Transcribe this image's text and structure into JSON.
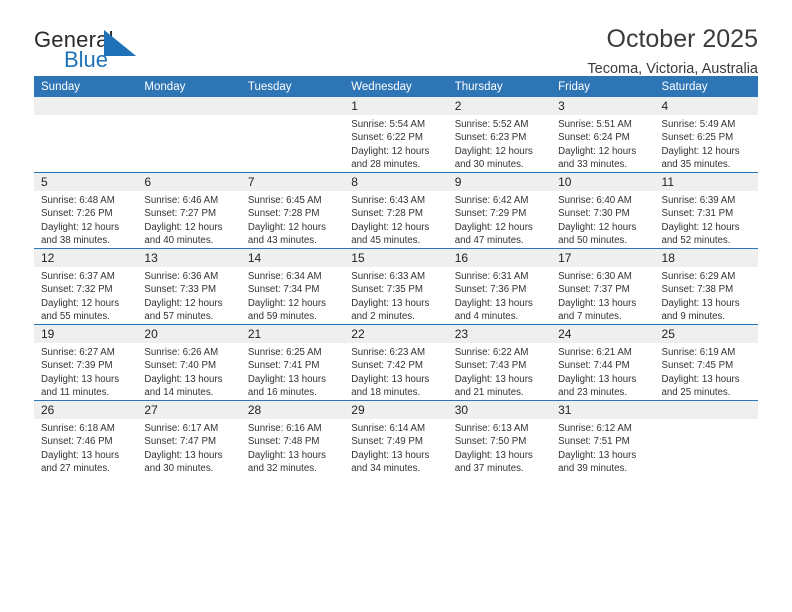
{
  "brand": {
    "name_part1": "General",
    "name_part2": "Blue",
    "triangle_color": "#1f72b8",
    "icon": "triangle-icon"
  },
  "header": {
    "title": "October 2025",
    "location": "Tecoma, Victoria, Australia"
  },
  "colors": {
    "header_blue": "#2e75b6",
    "daynum_band": "#efefef",
    "text": "#333333"
  },
  "weekdays": [
    "Sunday",
    "Monday",
    "Tuesday",
    "Wednesday",
    "Thursday",
    "Friday",
    "Saturday"
  ],
  "labels": {
    "sunrise": "Sunrise:",
    "sunset": "Sunset:",
    "daylight": "Daylight:"
  },
  "weeks": [
    [
      {
        "day": "",
        "empty": true
      },
      {
        "day": "",
        "empty": true
      },
      {
        "day": "",
        "empty": true
      },
      {
        "day": "1",
        "sunrise": "Sunrise: 5:54 AM",
        "sunset": "Sunset: 6:22 PM",
        "daylight_line1": "Daylight: 12 hours",
        "daylight_line2": "and 28 minutes."
      },
      {
        "day": "2",
        "sunrise": "Sunrise: 5:52 AM",
        "sunset": "Sunset: 6:23 PM",
        "daylight_line1": "Daylight: 12 hours",
        "daylight_line2": "and 30 minutes."
      },
      {
        "day": "3",
        "sunrise": "Sunrise: 5:51 AM",
        "sunset": "Sunset: 6:24 PM",
        "daylight_line1": "Daylight: 12 hours",
        "daylight_line2": "and 33 minutes."
      },
      {
        "day": "4",
        "sunrise": "Sunrise: 5:49 AM",
        "sunset": "Sunset: 6:25 PM",
        "daylight_line1": "Daylight: 12 hours",
        "daylight_line2": "and 35 minutes."
      }
    ],
    [
      {
        "day": "5",
        "sunrise": "Sunrise: 6:48 AM",
        "sunset": "Sunset: 7:26 PM",
        "daylight_line1": "Daylight: 12 hours",
        "daylight_line2": "and 38 minutes."
      },
      {
        "day": "6",
        "sunrise": "Sunrise: 6:46 AM",
        "sunset": "Sunset: 7:27 PM",
        "daylight_line1": "Daylight: 12 hours",
        "daylight_line2": "and 40 minutes."
      },
      {
        "day": "7",
        "sunrise": "Sunrise: 6:45 AM",
        "sunset": "Sunset: 7:28 PM",
        "daylight_line1": "Daylight: 12 hours",
        "daylight_line2": "and 43 minutes."
      },
      {
        "day": "8",
        "sunrise": "Sunrise: 6:43 AM",
        "sunset": "Sunset: 7:28 PM",
        "daylight_line1": "Daylight: 12 hours",
        "daylight_line2": "and 45 minutes."
      },
      {
        "day": "9",
        "sunrise": "Sunrise: 6:42 AM",
        "sunset": "Sunset: 7:29 PM",
        "daylight_line1": "Daylight: 12 hours",
        "daylight_line2": "and 47 minutes."
      },
      {
        "day": "10",
        "sunrise": "Sunrise: 6:40 AM",
        "sunset": "Sunset: 7:30 PM",
        "daylight_line1": "Daylight: 12 hours",
        "daylight_line2": "and 50 minutes."
      },
      {
        "day": "11",
        "sunrise": "Sunrise: 6:39 AM",
        "sunset": "Sunset: 7:31 PM",
        "daylight_line1": "Daylight: 12 hours",
        "daylight_line2": "and 52 minutes."
      }
    ],
    [
      {
        "day": "12",
        "sunrise": "Sunrise: 6:37 AM",
        "sunset": "Sunset: 7:32 PM",
        "daylight_line1": "Daylight: 12 hours",
        "daylight_line2": "and 55 minutes."
      },
      {
        "day": "13",
        "sunrise": "Sunrise: 6:36 AM",
        "sunset": "Sunset: 7:33 PM",
        "daylight_line1": "Daylight: 12 hours",
        "daylight_line2": "and 57 minutes."
      },
      {
        "day": "14",
        "sunrise": "Sunrise: 6:34 AM",
        "sunset": "Sunset: 7:34 PM",
        "daylight_line1": "Daylight: 12 hours",
        "daylight_line2": "and 59 minutes."
      },
      {
        "day": "15",
        "sunrise": "Sunrise: 6:33 AM",
        "sunset": "Sunset: 7:35 PM",
        "daylight_line1": "Daylight: 13 hours",
        "daylight_line2": "and 2 minutes."
      },
      {
        "day": "16",
        "sunrise": "Sunrise: 6:31 AM",
        "sunset": "Sunset: 7:36 PM",
        "daylight_line1": "Daylight: 13 hours",
        "daylight_line2": "and 4 minutes."
      },
      {
        "day": "17",
        "sunrise": "Sunrise: 6:30 AM",
        "sunset": "Sunset: 7:37 PM",
        "daylight_line1": "Daylight: 13 hours",
        "daylight_line2": "and 7 minutes."
      },
      {
        "day": "18",
        "sunrise": "Sunrise: 6:29 AM",
        "sunset": "Sunset: 7:38 PM",
        "daylight_line1": "Daylight: 13 hours",
        "daylight_line2": "and 9 minutes."
      }
    ],
    [
      {
        "day": "19",
        "sunrise": "Sunrise: 6:27 AM",
        "sunset": "Sunset: 7:39 PM",
        "daylight_line1": "Daylight: 13 hours",
        "daylight_line2": "and 11 minutes."
      },
      {
        "day": "20",
        "sunrise": "Sunrise: 6:26 AM",
        "sunset": "Sunset: 7:40 PM",
        "daylight_line1": "Daylight: 13 hours",
        "daylight_line2": "and 14 minutes."
      },
      {
        "day": "21",
        "sunrise": "Sunrise: 6:25 AM",
        "sunset": "Sunset: 7:41 PM",
        "daylight_line1": "Daylight: 13 hours",
        "daylight_line2": "and 16 minutes."
      },
      {
        "day": "22",
        "sunrise": "Sunrise: 6:23 AM",
        "sunset": "Sunset: 7:42 PM",
        "daylight_line1": "Daylight: 13 hours",
        "daylight_line2": "and 18 minutes."
      },
      {
        "day": "23",
        "sunrise": "Sunrise: 6:22 AM",
        "sunset": "Sunset: 7:43 PM",
        "daylight_line1": "Daylight: 13 hours",
        "daylight_line2": "and 21 minutes."
      },
      {
        "day": "24",
        "sunrise": "Sunrise: 6:21 AM",
        "sunset": "Sunset: 7:44 PM",
        "daylight_line1": "Daylight: 13 hours",
        "daylight_line2": "and 23 minutes."
      },
      {
        "day": "25",
        "sunrise": "Sunrise: 6:19 AM",
        "sunset": "Sunset: 7:45 PM",
        "daylight_line1": "Daylight: 13 hours",
        "daylight_line2": "and 25 minutes."
      }
    ],
    [
      {
        "day": "26",
        "sunrise": "Sunrise: 6:18 AM",
        "sunset": "Sunset: 7:46 PM",
        "daylight_line1": "Daylight: 13 hours",
        "daylight_line2": "and 27 minutes."
      },
      {
        "day": "27",
        "sunrise": "Sunrise: 6:17 AM",
        "sunset": "Sunset: 7:47 PM",
        "daylight_line1": "Daylight: 13 hours",
        "daylight_line2": "and 30 minutes."
      },
      {
        "day": "28",
        "sunrise": "Sunrise: 6:16 AM",
        "sunset": "Sunset: 7:48 PM",
        "daylight_line1": "Daylight: 13 hours",
        "daylight_line2": "and 32 minutes."
      },
      {
        "day": "29",
        "sunrise": "Sunrise: 6:14 AM",
        "sunset": "Sunset: 7:49 PM",
        "daylight_line1": "Daylight: 13 hours",
        "daylight_line2": "and 34 minutes."
      },
      {
        "day": "30",
        "sunrise": "Sunrise: 6:13 AM",
        "sunset": "Sunset: 7:50 PM",
        "daylight_line1": "Daylight: 13 hours",
        "daylight_line2": "and 37 minutes."
      },
      {
        "day": "31",
        "sunrise": "Sunrise: 6:12 AM",
        "sunset": "Sunset: 7:51 PM",
        "daylight_line1": "Daylight: 13 hours",
        "daylight_line2": "and 39 minutes."
      },
      {
        "day": "",
        "empty": true
      }
    ]
  ]
}
